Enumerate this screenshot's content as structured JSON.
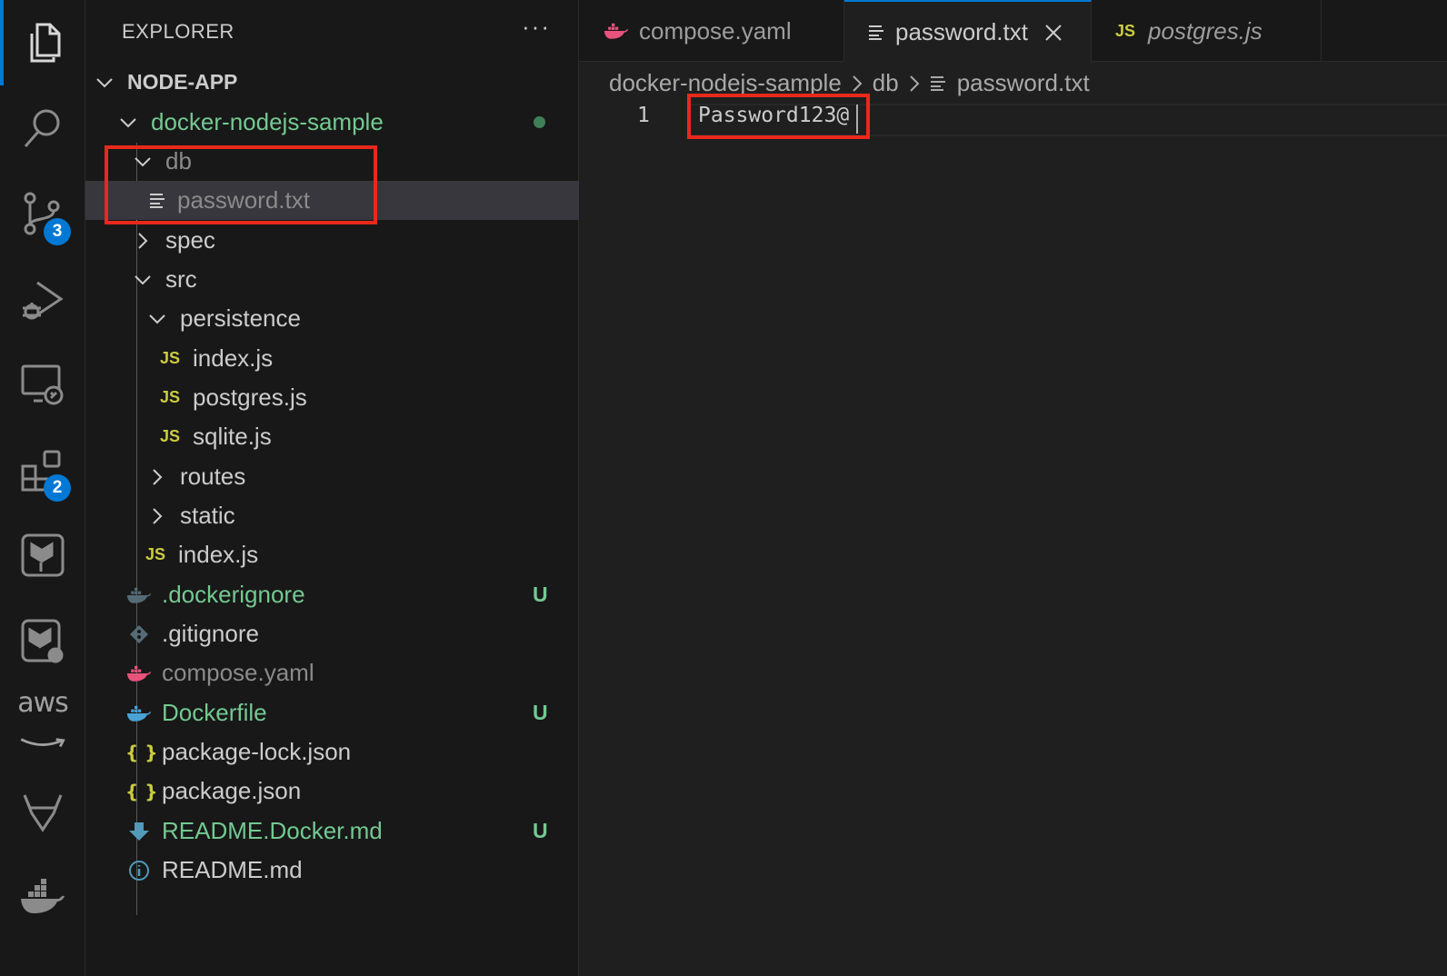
{
  "sidebar": {
    "title": "EXPLORER",
    "more": "···",
    "rows": [
      {
        "label": "NODE-APP",
        "color": "#cccccc"
      },
      {
        "label": "docker-nodejs-sample",
        "color": "#73c991"
      },
      {
        "label": "db",
        "color": "#8b8b8b"
      },
      {
        "label": "password.txt",
        "color": "#8b8b8b"
      },
      {
        "label": "spec",
        "color": "#cccccc"
      },
      {
        "label": "src",
        "color": "#cccccc"
      },
      {
        "label": "persistence",
        "color": "#cccccc"
      },
      {
        "label": "index.js",
        "color": "#cccccc",
        "icon": "JS"
      },
      {
        "label": "postgres.js",
        "color": "#cccccc",
        "icon": "JS"
      },
      {
        "label": "sqlite.js",
        "color": "#cccccc",
        "icon": "JS"
      },
      {
        "label": "routes",
        "color": "#cccccc"
      },
      {
        "label": "static",
        "color": "#cccccc"
      },
      {
        "label": "index.js",
        "color": "#cccccc",
        "icon": "JS"
      },
      {
        "label": ".dockerignore",
        "color": "#73c991",
        "status": "U"
      },
      {
        "label": ".gitignore",
        "color": "#cccccc"
      },
      {
        "label": "compose.yaml",
        "color": "#8b8b8b"
      },
      {
        "label": "Dockerfile",
        "color": "#73c991",
        "status": "U"
      },
      {
        "label": "package-lock.json",
        "color": "#cccccc",
        "icon": "{ }"
      },
      {
        "label": "package.json",
        "color": "#cccccc",
        "icon": "{ }"
      },
      {
        "label": "README.Docker.md",
        "color": "#73c991",
        "status": "U"
      },
      {
        "label": "README.md",
        "color": "#cccccc"
      }
    ]
  },
  "activity": {
    "scm_badge": "3",
    "extensions_badge": "2",
    "aws_label": "aws"
  },
  "tabs": [
    {
      "label": "compose.yaml"
    },
    {
      "label": "password.txt",
      "active": true
    },
    {
      "label": "postgres.js",
      "icon": "JS"
    }
  ],
  "breadcrumb": [
    "docker-nodejs-sample",
    "db",
    "password.txt"
  ],
  "editor": {
    "line_number": "1",
    "content": "Password123@"
  },
  "colors": {
    "accent": "#0078d4",
    "highlight_box": "#e8291c",
    "untracked": "#73c991"
  }
}
